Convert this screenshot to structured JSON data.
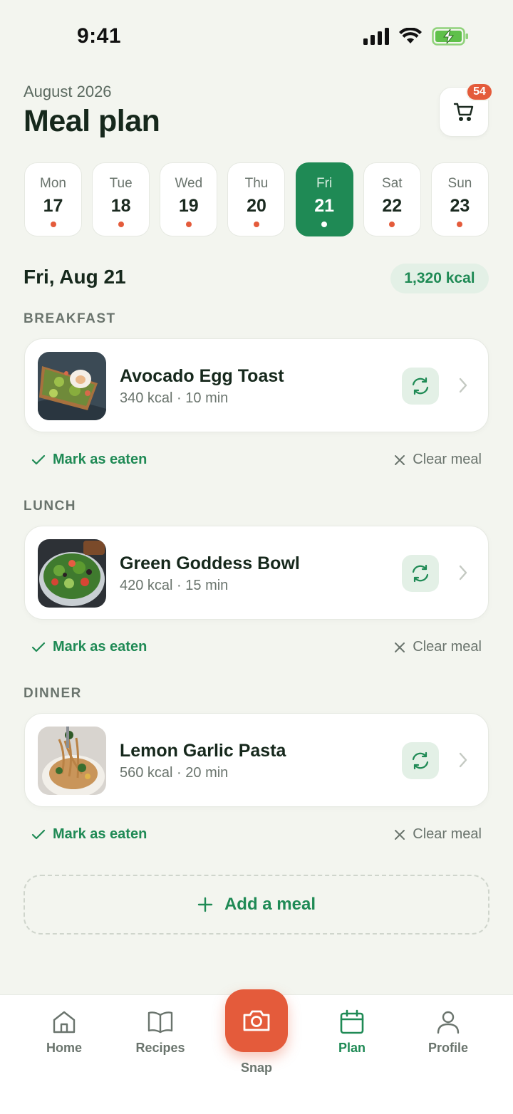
{
  "status": {
    "time": "9:41"
  },
  "header": {
    "month": "August 2026",
    "title": "Meal plan",
    "cart_count": "54"
  },
  "week": [
    {
      "name": "Mon",
      "num": "17"
    },
    {
      "name": "Tue",
      "num": "18"
    },
    {
      "name": "Wed",
      "num": "19"
    },
    {
      "name": "Thu",
      "num": "20"
    },
    {
      "name": "Fri",
      "num": "21"
    },
    {
      "name": "Sat",
      "num": "22"
    },
    {
      "name": "Sun",
      "num": "23"
    }
  ],
  "selected_day": "Fri",
  "day": {
    "heading": "Fri, Aug 21",
    "total_kcal": "1,320 kcal"
  },
  "meals": [
    {
      "section": "BREAKFAST",
      "name": "Avocado Egg Toast",
      "meta": "340 kcal · 10 min",
      "mark_label": "Mark as eaten",
      "clear_label": "Clear meal"
    },
    {
      "section": "LUNCH",
      "name": "Green Goddess Bowl",
      "meta": "420 kcal · 15 min",
      "mark_label": "Mark as eaten",
      "clear_label": "Clear meal"
    },
    {
      "section": "DINNER",
      "name": "Lemon Garlic Pasta",
      "meta": "560 kcal · 20 min",
      "mark_label": "Mark as eaten",
      "clear_label": "Clear meal"
    }
  ],
  "add_meal_label": "Add a meal",
  "nav": {
    "home": "Home",
    "recipes": "Recipes",
    "snap": "Snap",
    "plan": "Plan",
    "profile": "Profile",
    "active": "Plan"
  },
  "colors": {
    "accent": "#1f8a55",
    "orange": "#e45b3b",
    "background": "#f3f5ef"
  },
  "icons": [
    "signal-icon",
    "wifi-icon",
    "battery-charging-icon",
    "cart-icon",
    "swap-icon",
    "chevron-right-icon",
    "check-icon",
    "close-icon",
    "plus-icon",
    "home-icon",
    "book-icon",
    "camera-icon",
    "calendar-icon",
    "user-icon"
  ]
}
